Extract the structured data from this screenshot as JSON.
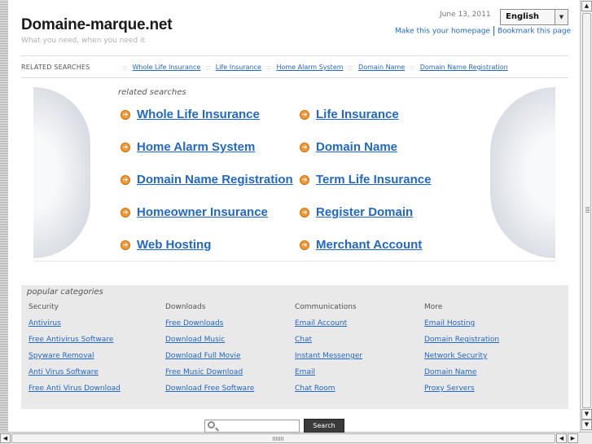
{
  "header": {
    "site_title": "Domaine-marque.net",
    "tagline": "What you need, when you need it",
    "date": "June 13, 2011",
    "language": "English",
    "make_homepage": "Make this your homepage",
    "bookmark": "Bookmark this page"
  },
  "related_bar": {
    "label": "RELATED SEARCHES",
    "separator": "::",
    "links": [
      "Whole Life Insurance",
      "Life Insurance",
      "Home Alarm System",
      "Domain Name",
      "Domain Name Registration"
    ]
  },
  "main": {
    "label": "related searches",
    "links": [
      "Whole Life Insurance",
      "Life Insurance",
      "Home Alarm System",
      "Domain Name",
      "Domain Name Registration",
      "Term Life Insurance",
      "Homeowner Insurance",
      "Register Domain",
      "Web Hosting",
      "Merchant Account"
    ]
  },
  "popular": {
    "title": "popular categories",
    "columns": [
      {
        "heading": "Security",
        "links": [
          "Antivirus",
          "Free Antivirus Software",
          "Spyware Removal",
          "Anti Virus Software",
          "Free Anti Virus Download"
        ]
      },
      {
        "heading": "Downloads",
        "links": [
          "Free Downloads",
          "Download Music",
          "Download Full Movie",
          "Free Music Download",
          "Download Free Software"
        ]
      },
      {
        "heading": "Communications",
        "links": [
          "Email Account",
          "Chat",
          "Instant Messenger",
          "Email",
          "Chat Room"
        ]
      },
      {
        "heading": "More",
        "links": [
          "Email Hosting",
          "Domain Registration",
          "Network Security",
          "Domain Name",
          "Proxy Servers"
        ]
      }
    ]
  },
  "search": {
    "button": "Search",
    "value": ""
  },
  "icons": {
    "link_arrow": "orange-circle-arrow-icon",
    "search": "magnifier-icon",
    "dropdown": "triangle-down-icon"
  },
  "colors": {
    "link": "#2168c8",
    "arrow": "#f09a36",
    "panel": "#e9e9e9"
  }
}
